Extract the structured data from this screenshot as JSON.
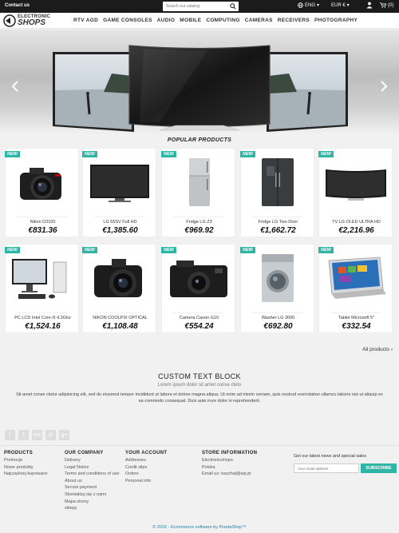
{
  "topbar": {
    "contact": "Contact us",
    "search_placeholder": "Search our catalog",
    "language": "ENG",
    "currency": "EUR €",
    "cart_count": "(0)"
  },
  "header": {
    "logo_line1": "ELECTRONIC",
    "logo_line2": "SHOPS",
    "nav": [
      "RTV AGD",
      "GAME CONSOLES",
      "AUDIO",
      "MOBILE",
      "COMPUTING",
      "CAMERAS",
      "RECEIVERS",
      "PHOTOGRAPHY"
    ]
  },
  "popular": {
    "title": "POPULAR PRODUCTS",
    "badge": "NEW",
    "products": [
      {
        "name": "Nikon D3100",
        "price": "€831.36",
        "icon": "camera-icon"
      },
      {
        "name": "LG 65SV Full HD",
        "price": "€1,385.60",
        "icon": "tv-icon"
      },
      {
        "name": "Fridge LG Z3",
        "price": "€969.92",
        "icon": "fridge-icon"
      },
      {
        "name": "Fridge LG Two Door",
        "price": "€1,662.72",
        "icon": "double-fridge-icon"
      },
      {
        "name": "TV LG OLED ULTRA HD",
        "price": "€2,216.96",
        "icon": "curved-tv-icon"
      },
      {
        "name": "PC LCD Intel Core i5 4.3Ghz",
        "price": "€1,524.16",
        "icon": "desktop-pc-icon"
      },
      {
        "name": "NIKON COOLPIX OPTICAL",
        "price": "€1,108.48",
        "icon": "camera-icon"
      },
      {
        "name": "Camera Canon G10",
        "price": "€554.24",
        "icon": "compact-camera-icon"
      },
      {
        "name": "Washer LG 3000",
        "price": "€692.80",
        "icon": "washer-icon"
      },
      {
        "name": "Tablet Microsoft 5\"",
        "price": "€332.54",
        "icon": "tablet-icon"
      }
    ],
    "all_link": "All products ›"
  },
  "custom_block": {
    "title": "CUSTOM TEXT BLOCK",
    "subtitle": "Lorem ipsum dolor sit amet conse ctetu",
    "text": "Sit amet conse ctetur adipisicing elit, sed do eiusmod tempor incididunt ut labore et dolore magna aliqua. Ut enim ad minim veniam, quis nostrud exercitation ullamco laboris nisi ut aliquip ex ea commodo consequat. Duis aute irure dolor in reprehenderit."
  },
  "social": [
    "f",
    "t",
    "rss",
    "yt",
    "g+"
  ],
  "footer": {
    "products": {
      "title": "PRODUCTS",
      "items": [
        "Promocje",
        "Nowe produkty",
        "Najczęściej kupowane"
      ]
    },
    "company": {
      "title": "OUR COMPANY",
      "items": [
        "Delivery",
        "Legal Notice",
        "Terms and conditions of use",
        "About us",
        "Secure payment",
        "Skontaktuj się z nami",
        "Mapa strony",
        "sklepy"
      ]
    },
    "account": {
      "title": "YOUR ACCOUNT",
      "items": [
        "Addresses",
        "Credit slips",
        "Orders",
        "Personal info"
      ]
    },
    "store": {
      "title": "STORE INFORMATION",
      "items": [
        "Electronicshops",
        "Polska",
        "Email us: hazzhal@wp.pl"
      ]
    },
    "newsletter": {
      "label": "Get our latest news and special sales",
      "placeholder": "Your email address",
      "button": "SUBSCRIBE"
    },
    "copyright": "© 2016 - Ecommerce software by PrestaShop™"
  },
  "colors": {
    "accent": "#2fb5a6",
    "topbar": "#1b1b1b"
  }
}
